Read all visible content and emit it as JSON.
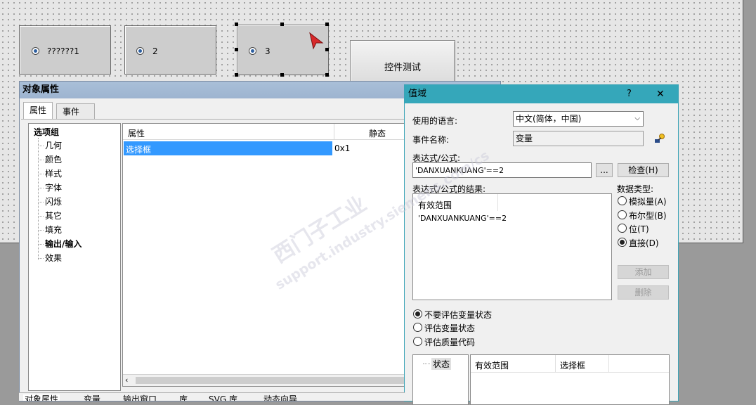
{
  "canvas": {
    "radio_boxes": [
      {
        "label": "??????1"
      },
      {
        "label": "2"
      },
      {
        "label": "3"
      }
    ],
    "test_button": "控件测试"
  },
  "prop_panel": {
    "title": "对象属性",
    "tabs": [
      "属性",
      "事件"
    ],
    "tree_root": "选项组",
    "tree_items": [
      "几何",
      "颜色",
      "样式",
      "字体",
      "闪烁",
      "其它",
      "填充",
      "输出/输入",
      "效果"
    ],
    "tree_selected": "输出/输入",
    "grid_headers": [
      "属性",
      "静态"
    ],
    "grid_row": {
      "name": "选择框",
      "value": "0x1"
    }
  },
  "dialog": {
    "title": "值域",
    "help": "?",
    "close": "✕",
    "language_label": "使用的语言:",
    "language_value": "中文(简体，中国)",
    "event_label": "事件名称:",
    "event_value": "变量",
    "expr_label": "表达式/公式:",
    "expr_value": "'DANXUANKUANG'==2",
    "browse_btn": "...",
    "check_btn": "检查(H)",
    "result_label": "表达式/公式的结果:",
    "result_header": "有效范围",
    "result_row": "'DANXUANKUANG'==2",
    "datatype_label": "数据类型:",
    "datatypes": [
      "模拟量(A)",
      "布尔型(B)",
      "位(T)",
      "直接(D)"
    ],
    "datatype_selected": "直接(D)",
    "add_btn": "添加",
    "delete_btn": "删除",
    "eval_options": [
      "不要评估变量状态",
      "评估变量状态",
      "评估质量代码"
    ],
    "eval_selected": "不要评估变量状态",
    "status_tree_item": "状态",
    "bottom_headers": [
      "有效范围",
      "选择框"
    ]
  },
  "bottom_tabs": [
    "对象属性",
    "变量",
    "输出窗口",
    "库",
    "SVG 库",
    "动态向导"
  ],
  "watermark": {
    "line1": "西门子工业",
    "line2": "support.industry.siemens.com/cs"
  }
}
